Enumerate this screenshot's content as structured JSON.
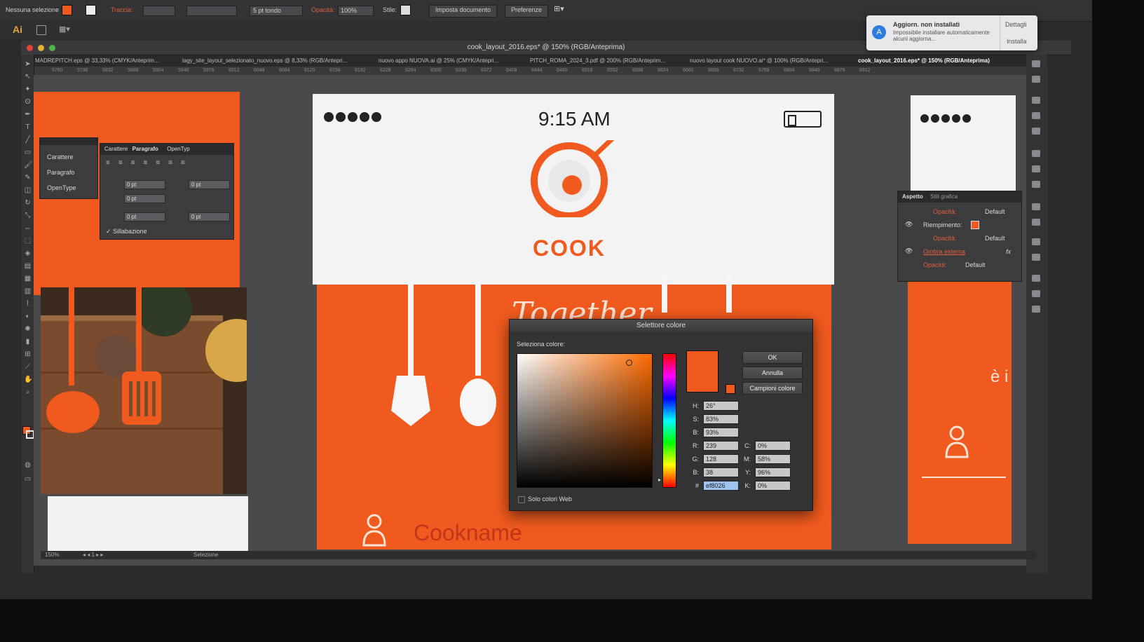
{
  "control_bar": {
    "selection": "Nessuna selezione",
    "stroke_label": "Traccia:",
    "brush": "5 pt tondo",
    "opacity_label": "Opacità:",
    "opacity_value": "100%",
    "style_label": "Stile:",
    "doc_setup_button": "Imposta documento",
    "prefs_button": "Preferenze"
  },
  "app": {
    "logo": "Ai"
  },
  "window": {
    "title": "cook_layout_2016.eps* @ 150% (RGB/Anteprima)"
  },
  "tabs": [
    {
      "label": "MADREPITCH.eps @ 33,33% (CMYK/Anteprim..."
    },
    {
      "label": "lagy_site_layout_selezionato_nuovo.eps @ 8,33% (RGB/Anteprі..."
    },
    {
      "label": "nuovo appo NUOVA.ai @ 25% (CMYK/Antepri..."
    },
    {
      "label": "PITCH_ROMA_2024_3.pdf @ 200% (RGB/Anteprim..."
    },
    {
      "label": "nuovo layout cook NUOVO.ai* @ 100% (RGB/Antepri..."
    },
    {
      "label": "cook_layout_2016.eps* @ 150% (RGB/Anteprima)"
    }
  ],
  "ruler_ticks": [
    "5760",
    "5796",
    "5832",
    "5868",
    "5904",
    "5940",
    "5976",
    "6012",
    "6048",
    "6084",
    "6120",
    "6156",
    "6192",
    "6228",
    "6264",
    "6300",
    "6336",
    "6372",
    "6408",
    "6444",
    "6480",
    "6516",
    "6552",
    "6588",
    "6624",
    "6660",
    "6696",
    "6732",
    "6768",
    "6804",
    "6840",
    "6876",
    "6912"
  ],
  "notification": {
    "title": "Aggiorn. non installati",
    "body": "Impossibile installare automaticamente alcuni aggiorna...",
    "details_button": "Dettagli",
    "install_button": "Installa"
  },
  "char_panel": {
    "items": [
      "Carattere",
      "Paragrafo",
      "OpenType"
    ],
    "tabs": [
      "Carattere",
      "Paragrafo",
      "OpenTyp"
    ],
    "fields": [
      "0 pt",
      "0 pt",
      "0 pt",
      "0 pt",
      "0 pt"
    ],
    "hyphenation": "Sillabazione"
  },
  "appearance_panel": {
    "tabs": [
      "Aspetto",
      "Stili grafica"
    ],
    "rows": [
      {
        "label": "Opacità:",
        "value": "Default"
      },
      {
        "label": "Riempimento:",
        "value": ""
      },
      {
        "label": "Opacità:",
        "value": "Default"
      },
      {
        "label": "Ombra esterna",
        "value": ""
      },
      {
        "label": "Opacità:",
        "value": "Default"
      }
    ]
  },
  "mockup": {
    "time": "9:15 AM",
    "brand": "COOK",
    "headline": "Together",
    "username": "Cookname",
    "side_text": "è i"
  },
  "color_picker": {
    "title": "Selettore colore",
    "select_label": "Seleziona colore:",
    "ok": "OK",
    "cancel": "Annulla",
    "swatches": "Campioni colore",
    "web_only": "Solo colori Web",
    "H": "26°",
    "S": "83%",
    "B": "93%",
    "R": "239",
    "G": "128",
    "Bv": "38",
    "C": "0%",
    "M": "58%",
    "Y": "96%",
    "K": "0%",
    "hex": "ef8026",
    "color": "#ef8026"
  },
  "status": {
    "zoom": "150%",
    "tool": "Selezione"
  },
  "colors": {
    "accent": "#f05a1e",
    "ui_dark": "#2b2b2d"
  }
}
